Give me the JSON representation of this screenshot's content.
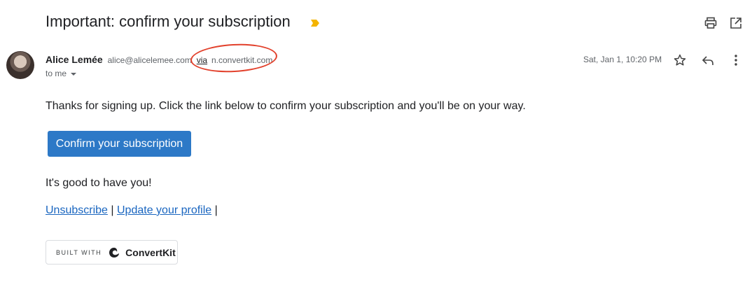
{
  "email": {
    "subject": "Important: confirm your subscription",
    "sender": {
      "name": "Alice Lemée",
      "email": "alice@alicelemee.com",
      "via_label": "via",
      "via_domain": "n.convertkit.com"
    },
    "recipient_label": "to me",
    "date": "Sat, Jan 1, 10:20 PM",
    "body": {
      "intro": "Thanks for signing up. Click the link below to confirm your subscription and you'll be on your way.",
      "confirm_button": "Confirm your subscription",
      "closing": "It's good to have you!",
      "unsubscribe_link": "Unsubscribe",
      "separator": "|",
      "update_profile_link": "Update your profile",
      "trailing_separator": "|"
    },
    "footer_badge": {
      "prefix": "BUILT WITH",
      "brand": "ConvertKit"
    }
  },
  "colors": {
    "button": "#2d79c7",
    "link": "#1a66c0",
    "annotation": "#e2412c",
    "important_marker": "#f4b400"
  },
  "icons": [
    "important-marker-icon",
    "print-icon",
    "open-in-new-window-icon",
    "star-icon",
    "reply-icon",
    "more-options-icon",
    "chevron-down-icon",
    "convertkit-logo-icon"
  ]
}
